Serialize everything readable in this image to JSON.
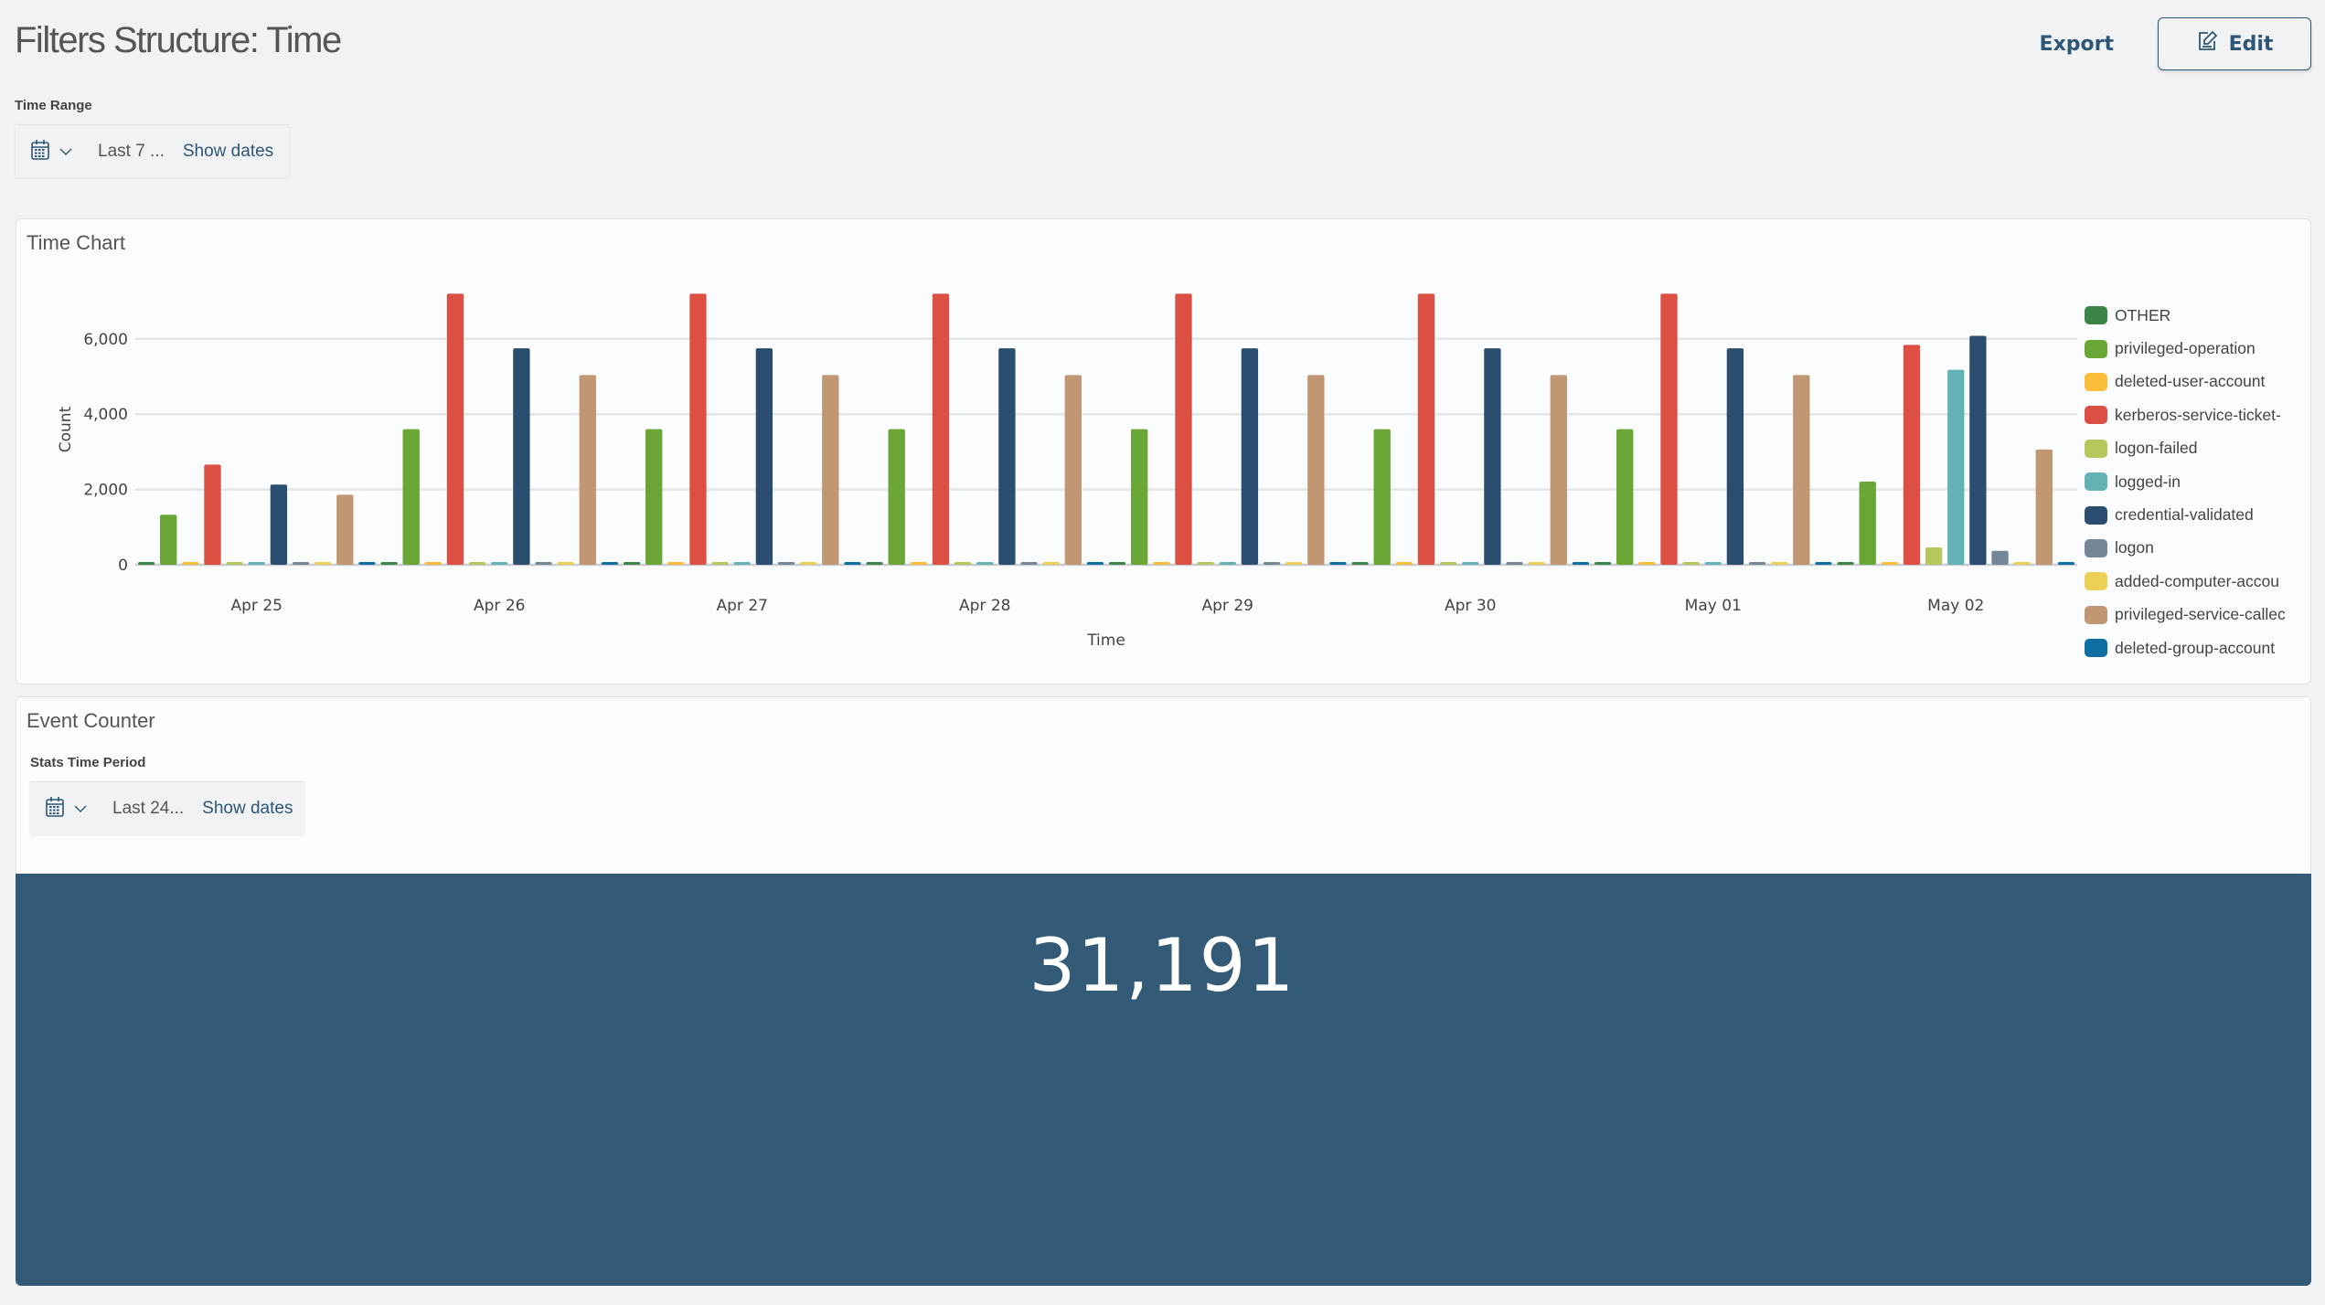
{
  "page": {
    "title": "Filters Structure: Time"
  },
  "header": {
    "export_label": "Export",
    "edit_label": "Edit",
    "edit_icon": "edit-icon"
  },
  "time_range": {
    "label": "Time Range",
    "calendar_icon": "calendar-icon",
    "value": "Last 7 ...",
    "show_dates_label": "Show dates"
  },
  "time_chart_panel": {
    "title": "Time Chart"
  },
  "event_counter_panel": {
    "title": "Event Counter",
    "stats_label": "Stats Time Period",
    "stats_value": "Last 24...",
    "show_dates_label": "Show dates",
    "count": "31,191",
    "count_bg_color": "#335a77"
  },
  "chart_data": {
    "type": "bar",
    "title": "Time Chart",
    "xlabel": "Time",
    "ylabel": "Count",
    "ylim": [
      0,
      7500
    ],
    "yticks": [
      0,
      2000,
      4000,
      6000
    ],
    "ytick_labels": [
      "0",
      "2,000",
      "4,000",
      "6,000"
    ],
    "grid": true,
    "legend_position": "right",
    "categories": [
      "Apr 25",
      "Apr 26",
      "Apr 27",
      "Apr 28",
      "Apr 29",
      "Apr 30",
      "May 01",
      "May 02"
    ],
    "series": [
      {
        "name": "OTHER",
        "color": "#3b8646",
        "values": [
          0,
          0,
          0,
          0,
          0,
          0,
          0,
          60
        ]
      },
      {
        "name": "privileged-operation",
        "color": "#69a636",
        "values": [
          1330,
          3600,
          3600,
          3600,
          3600,
          3600,
          3600,
          2210
        ]
      },
      {
        "name": "deleted-user-account",
        "color": "#fbbe3a",
        "values": [
          0,
          0,
          0,
          0,
          0,
          0,
          0,
          0
        ]
      },
      {
        "name": "kerberos-service-ticket-",
        "color": "#dc5044",
        "values": [
          2660,
          7200,
          7200,
          7200,
          7200,
          7200,
          7200,
          5840
        ]
      },
      {
        "name": "logon-failed",
        "color": "#b6c85b",
        "values": [
          0,
          0,
          0,
          0,
          0,
          0,
          0,
          460
        ]
      },
      {
        "name": "logged-in",
        "color": "#64b3b4",
        "values": [
          0,
          0,
          0,
          0,
          0,
          0,
          0,
          5180
        ]
      },
      {
        "name": "credential-validated",
        "color": "#2b4e70",
        "values": [
          2130,
          5750,
          5750,
          5750,
          5750,
          5750,
          5750,
          6080
        ]
      },
      {
        "name": "logon",
        "color": "#758797",
        "values": [
          0,
          0,
          0,
          0,
          0,
          0,
          0,
          370
        ]
      },
      {
        "name": "added-computer-accou",
        "color": "#ecd055",
        "values": [
          0,
          0,
          0,
          0,
          0,
          0,
          0,
          0
        ]
      },
      {
        "name": "privileged-service-callec",
        "color": "#c09772",
        "values": [
          1860,
          5040,
          5040,
          5040,
          5040,
          5040,
          5040,
          3060
        ]
      },
      {
        "name": "deleted-group-account",
        "color": "#0f6ea1",
        "values": [
          0,
          0,
          0,
          0,
          0,
          0,
          0,
          0
        ]
      }
    ]
  }
}
